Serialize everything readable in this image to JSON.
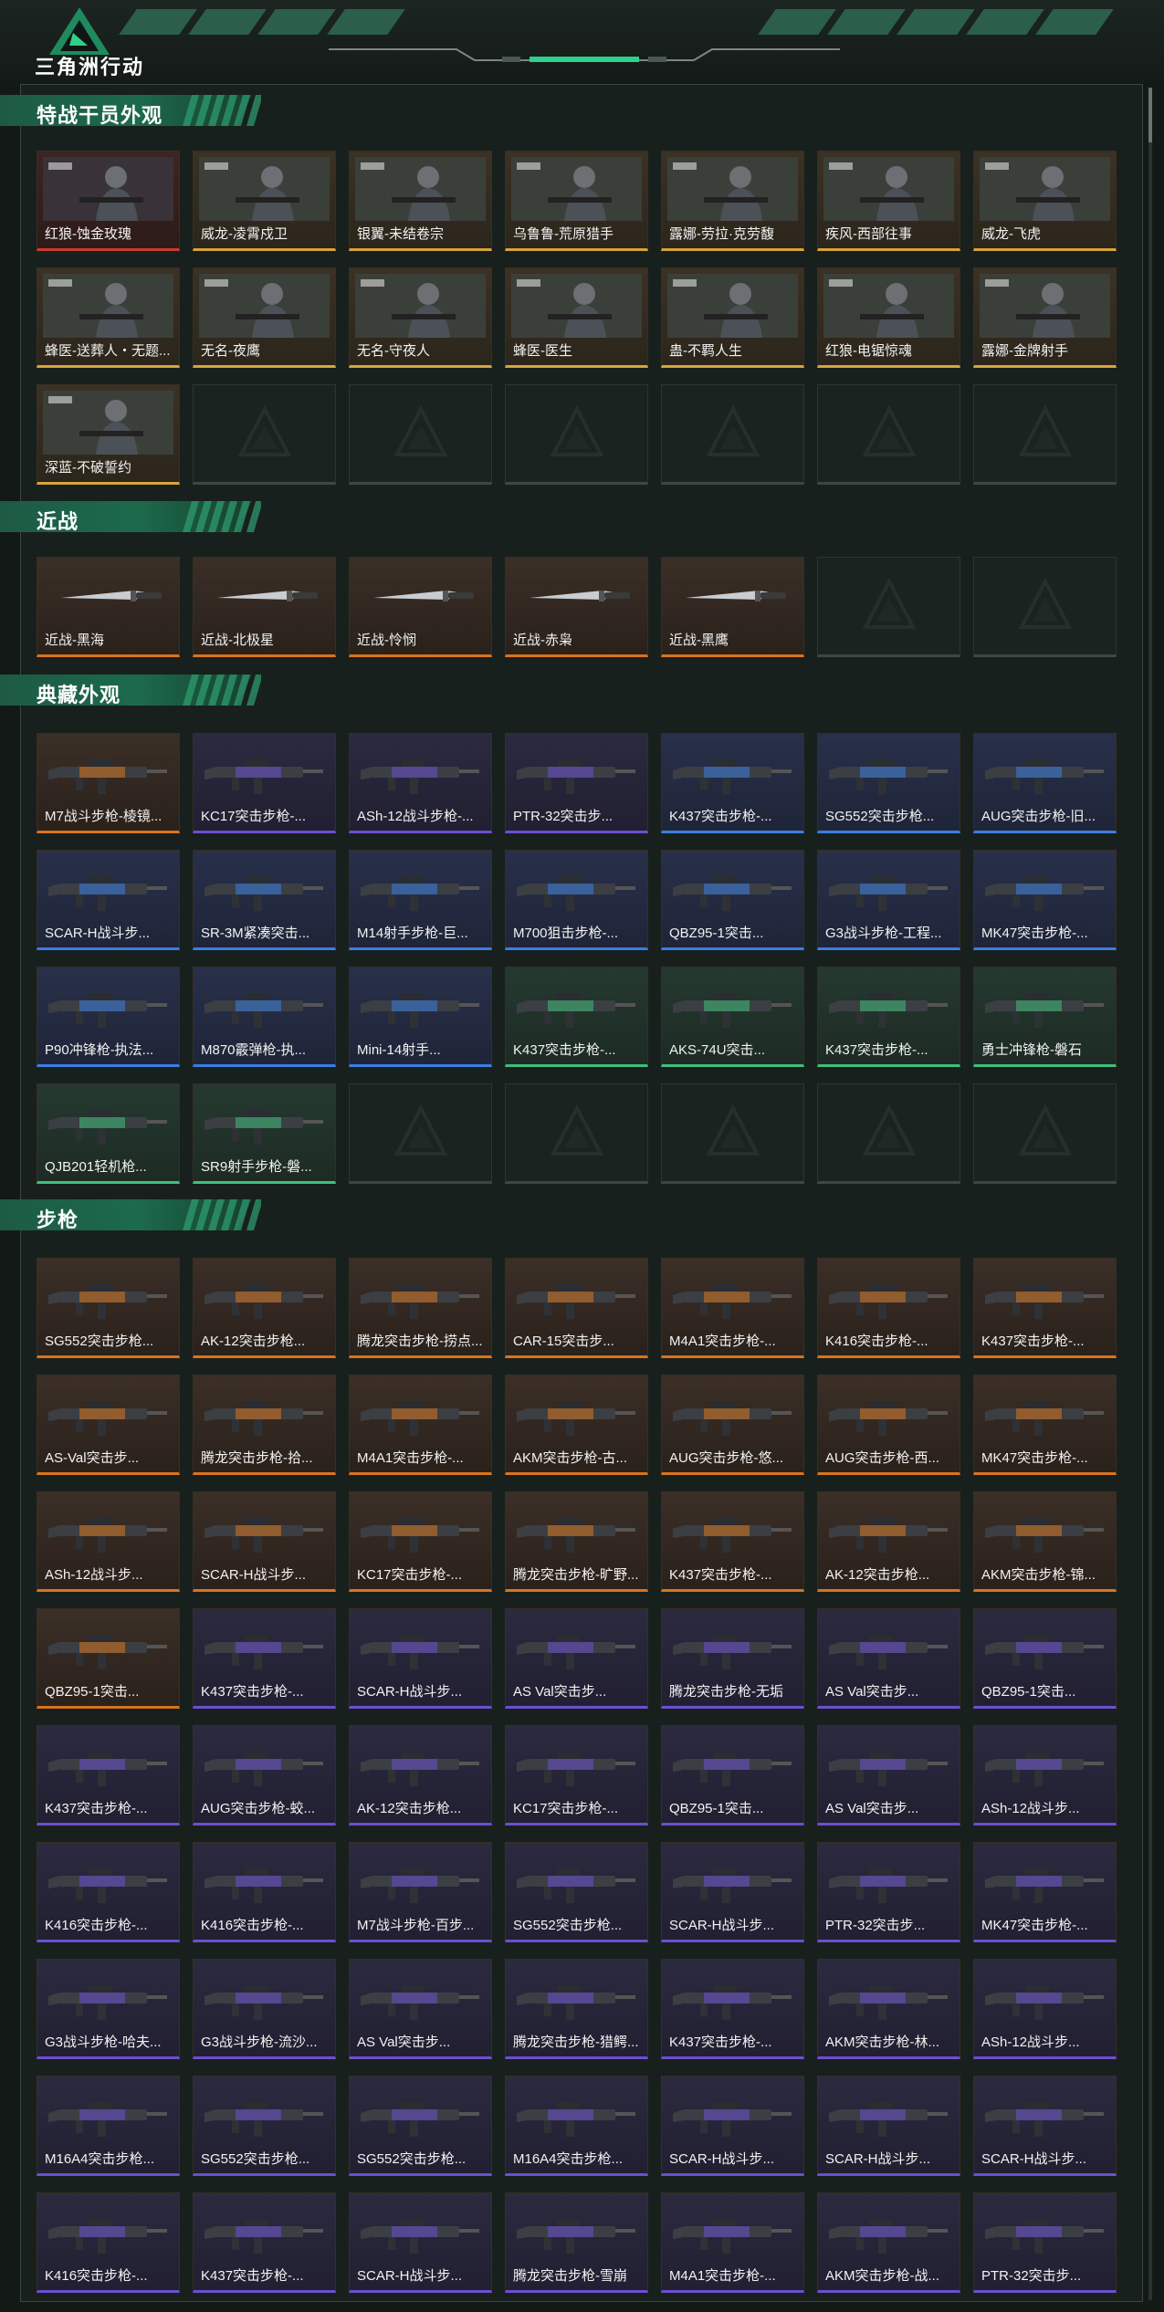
{
  "game_title": "三角洲行动",
  "sections": [
    {
      "id": "operator",
      "title": "特战干员外观",
      "items": [
        {
          "name": "红狼-蚀金玫瑰",
          "tier": "red"
        },
        {
          "name": "威龙-凌霄戍卫",
          "tier": "gold"
        },
        {
          "name": "银翼-未结卷宗",
          "tier": "gold"
        },
        {
          "name": "乌鲁鲁-荒原猎手",
          "tier": "gold"
        },
        {
          "name": "露娜-劳拉·克劳馥",
          "tier": "gold"
        },
        {
          "name": "疾风-西部往事",
          "tier": "gold"
        },
        {
          "name": "威龙-飞虎",
          "tier": "gold"
        },
        {
          "name": "蜂医-送葬人・无题...",
          "tier": "gold"
        },
        {
          "name": "无名-夜鹰",
          "tier": "gold"
        },
        {
          "name": "无名-守夜人",
          "tier": "gold"
        },
        {
          "name": "蜂医-医生",
          "tier": "gold"
        },
        {
          "name": "蛊-不羁人生",
          "tier": "gold"
        },
        {
          "name": "红狼-电锯惊魂",
          "tier": "gold"
        },
        {
          "name": "露娜-金牌射手",
          "tier": "gold"
        },
        {
          "name": "深蓝-不破誓约",
          "tier": "gold"
        }
      ],
      "empty_slots": 6
    },
    {
      "id": "melee",
      "title": "近战",
      "items": [
        {
          "name": "近战-黑海",
          "tier": "orange"
        },
        {
          "name": "近战-北极星",
          "tier": "orange"
        },
        {
          "name": "近战-怜悯",
          "tier": "orange"
        },
        {
          "name": "近战-赤枭",
          "tier": "orange"
        },
        {
          "name": "近战-黑鹰",
          "tier": "orange"
        }
      ],
      "empty_slots": 2
    },
    {
      "id": "collection",
      "title": "典藏外观",
      "items": [
        {
          "name": "M7战斗步枪-棱镜...",
          "tier": "orange"
        },
        {
          "name": "KC17突击步枪-...",
          "tier": "purple"
        },
        {
          "name": "ASh-12战斗步枪-...",
          "tier": "purple"
        },
        {
          "name": "PTR-32突击步...",
          "tier": "purple"
        },
        {
          "name": "K437突击步枪-...",
          "tier": "blue"
        },
        {
          "name": "SG552突击步枪...",
          "tier": "blue"
        },
        {
          "name": "AUG突击步枪-旧...",
          "tier": "blue"
        },
        {
          "name": "SCAR-H战斗步...",
          "tier": "blue"
        },
        {
          "name": "SR-3M紧凑突击...",
          "tier": "blue"
        },
        {
          "name": "M14射手步枪-巨...",
          "tier": "blue"
        },
        {
          "name": "M700狙击步枪-...",
          "tier": "blue"
        },
        {
          "name": "QBZ95-1突击...",
          "tier": "blue"
        },
        {
          "name": "G3战斗步枪-工程...",
          "tier": "blue"
        },
        {
          "name": "MK47突击步枪-...",
          "tier": "blue"
        },
        {
          "name": "P90冲锋枪-执法...",
          "tier": "blue"
        },
        {
          "name": "M870霰弹枪-执...",
          "tier": "blue"
        },
        {
          "name": "Mini-14射手...",
          "tier": "blue"
        },
        {
          "name": "K437突击步枪-...",
          "tier": "green"
        },
        {
          "name": "AKS-74U突击...",
          "tier": "green"
        },
        {
          "name": "K437突击步枪-...",
          "tier": "green"
        },
        {
          "name": "勇士冲锋枪-磐石",
          "tier": "green"
        },
        {
          "name": "QJB201轻机枪...",
          "tier": "green"
        },
        {
          "name": "SR9射手步枪-磐...",
          "tier": "green"
        }
      ],
      "empty_slots": 5
    },
    {
      "id": "rifle",
      "title": "步枪",
      "items": [
        {
          "name": "SG552突击步枪...",
          "tier": "orange"
        },
        {
          "name": "AK-12突击步枪...",
          "tier": "orange"
        },
        {
          "name": "腾龙突击步枪-捞点...",
          "tier": "orange"
        },
        {
          "name": "CAR-15突击步...",
          "tier": "orange"
        },
        {
          "name": "M4A1突击步枪-...",
          "tier": "orange"
        },
        {
          "name": "K416突击步枪-...",
          "tier": "orange"
        },
        {
          "name": "K437突击步枪-...",
          "tier": "orange"
        },
        {
          "name": "AS-Val突击步...",
          "tier": "orange"
        },
        {
          "name": "腾龙突击步枪-拾...",
          "tier": "orange"
        },
        {
          "name": "M4A1突击步枪-...",
          "tier": "orange"
        },
        {
          "name": "AKM突击步枪-古...",
          "tier": "orange"
        },
        {
          "name": "AUG突击步枪-悠...",
          "tier": "orange"
        },
        {
          "name": "AUG突击步枪-西...",
          "tier": "orange"
        },
        {
          "name": "MK47突击步枪-...",
          "tier": "orange"
        },
        {
          "name": "ASh-12战斗步...",
          "tier": "orange"
        },
        {
          "name": "SCAR-H战斗步...",
          "tier": "orange"
        },
        {
          "name": "KC17突击步枪-...",
          "tier": "orange"
        },
        {
          "name": "腾龙突击步枪-旷野...",
          "tier": "orange"
        },
        {
          "name": "K437突击步枪-...",
          "tier": "orange"
        },
        {
          "name": "AK-12突击步枪...",
          "tier": "orange"
        },
        {
          "name": "AKM突击步枪-锦...",
          "tier": "orange"
        },
        {
          "name": "QBZ95-1突击...",
          "tier": "orange"
        },
        {
          "name": "K437突击步枪-...",
          "tier": "purple"
        },
        {
          "name": "SCAR-H战斗步...",
          "tier": "purple"
        },
        {
          "name": "AS Val突击步...",
          "tier": "purple"
        },
        {
          "name": "腾龙突击步枪-无垢",
          "tier": "purple"
        },
        {
          "name": "AS Val突击步...",
          "tier": "purple"
        },
        {
          "name": "QBZ95-1突击...",
          "tier": "purple"
        },
        {
          "name": "K437突击步枪-...",
          "tier": "purple"
        },
        {
          "name": "AUG突击步枪-蛟...",
          "tier": "purple"
        },
        {
          "name": "AK-12突击步枪...",
          "tier": "purple"
        },
        {
          "name": "KC17突击步枪-...",
          "tier": "purple"
        },
        {
          "name": "QBZ95-1突击...",
          "tier": "purple"
        },
        {
          "name": "AS Val突击步...",
          "tier": "purple"
        },
        {
          "name": "ASh-12战斗步...",
          "tier": "purple"
        },
        {
          "name": "K416突击步枪-...",
          "tier": "purple"
        },
        {
          "name": "K416突击步枪-...",
          "tier": "purple"
        },
        {
          "name": "M7战斗步枪-百步...",
          "tier": "purple"
        },
        {
          "name": "SG552突击步枪...",
          "tier": "purple"
        },
        {
          "name": "SCAR-H战斗步...",
          "tier": "purple"
        },
        {
          "name": "PTR-32突击步...",
          "tier": "purple"
        },
        {
          "name": "MK47突击步枪-...",
          "tier": "purple"
        },
        {
          "name": "G3战斗步枪-哈夫...",
          "tier": "purple"
        },
        {
          "name": "G3战斗步枪-流沙...",
          "tier": "purple"
        },
        {
          "name": "AS Val突击步...",
          "tier": "purple"
        },
        {
          "name": "腾龙突击步枪-猎鳄...",
          "tier": "purple"
        },
        {
          "name": "K437突击步枪-...",
          "tier": "purple"
        },
        {
          "name": "AKM突击步枪-林...",
          "tier": "purple"
        },
        {
          "name": "ASh-12战斗步...",
          "tier": "purple"
        },
        {
          "name": "M16A4突击步枪...",
          "tier": "purple"
        },
        {
          "name": "SG552突击步枪...",
          "tier": "purple"
        },
        {
          "name": "SG552突击步枪...",
          "tier": "purple"
        },
        {
          "name": "M16A4突击步枪...",
          "tier": "purple"
        },
        {
          "name": "SCAR-H战斗步...",
          "tier": "purple"
        },
        {
          "name": "SCAR-H战斗步...",
          "tier": "purple"
        },
        {
          "name": "SCAR-H战斗步...",
          "tier": "purple"
        },
        {
          "name": "K416突击步枪-...",
          "tier": "purple"
        },
        {
          "name": "K437突击步枪-...",
          "tier": "purple"
        },
        {
          "name": "SCAR-H战斗步...",
          "tier": "purple"
        },
        {
          "name": "腾龙突击步枪-雪崩",
          "tier": "purple"
        },
        {
          "name": "M4A1突击步枪-...",
          "tier": "purple"
        },
        {
          "name": "AKM突击步枪-战...",
          "tier": "purple"
        },
        {
          "name": "PTR-32突击步...",
          "tier": "purple"
        }
      ],
      "empty_slots": 0
    }
  ],
  "colors": {
    "background": "#131917",
    "section_accent": "#1c6a4c",
    "orange": "#d8741e",
    "purple": "#6c4fd0",
    "blue": "#3a7ee0",
    "green": "#3fbf7a",
    "gold": "#d8a43a",
    "red": "#c93b2e"
  },
  "icons": {
    "logo": "delta-triangle-logo",
    "placeholder": "delta-triangle-placeholder-icon"
  }
}
